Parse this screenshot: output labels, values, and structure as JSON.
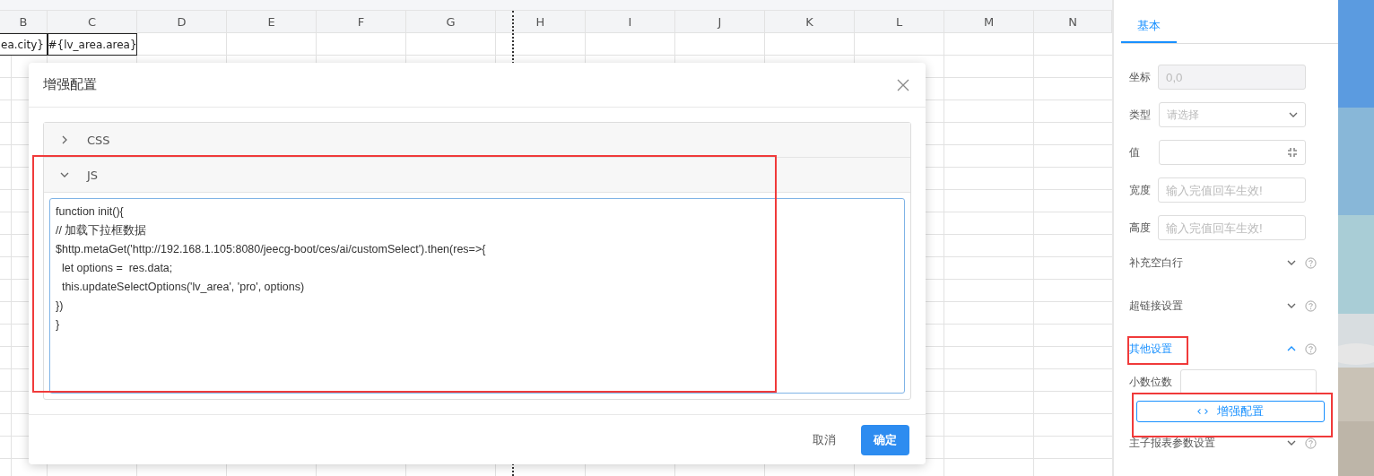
{
  "sheet": {
    "columns": [
      "B",
      "C",
      "D",
      "E",
      "F",
      "G",
      "H",
      "I",
      "J",
      "K",
      "L",
      "M",
      "N"
    ],
    "rows": [
      [
        "ea.city}",
        "#{lv_area.area}"
      ]
    ]
  },
  "dialog": {
    "title": "增强配置",
    "panels": [
      {
        "label": "CSS",
        "expanded": false
      },
      {
        "label": "JS",
        "expanded": true,
        "code": [
          "function init(){",
          "// 加载下拉框数据",
          "$http.metaGet('http://192.168.1.105:8080/jeecg-boot/ces/ai/customSelect').then(res=>{",
          "  let options =  res.data;",
          "  this.updateSelectOptions('lv_area', 'pro', options)",
          "})",
          "}"
        ]
      }
    ],
    "buttons": [
      {
        "label": "取消",
        "kind": "default"
      },
      {
        "label": "确定",
        "kind": "primary"
      }
    ]
  },
  "panel": {
    "tabs": [
      {
        "label": "基本",
        "selected": true
      }
    ],
    "fields": [
      {
        "label": "坐标",
        "kind": "text",
        "value": "0,0",
        "disabled": true
      },
      {
        "label": "类型",
        "kind": "select",
        "placeholder": "请选择",
        "disabled": false
      },
      {
        "label": "值",
        "kind": "expand",
        "disabled": false
      },
      {
        "label": "宽度",
        "kind": "text",
        "placeholder": "输入完值回车生效!",
        "disabled": false
      },
      {
        "label": "高度",
        "kind": "text",
        "placeholder": "输入完值回车生效!",
        "disabled": false
      }
    ],
    "sections": [
      {
        "label": "补充空白行",
        "expanded": false
      },
      {
        "label": "超链接设置",
        "expanded": false
      },
      {
        "label": "其他设置",
        "expanded": true,
        "field_label": "小数位数",
        "button": "增强配置"
      },
      {
        "label": "主子报表参数设置",
        "expanded": false
      }
    ]
  }
}
